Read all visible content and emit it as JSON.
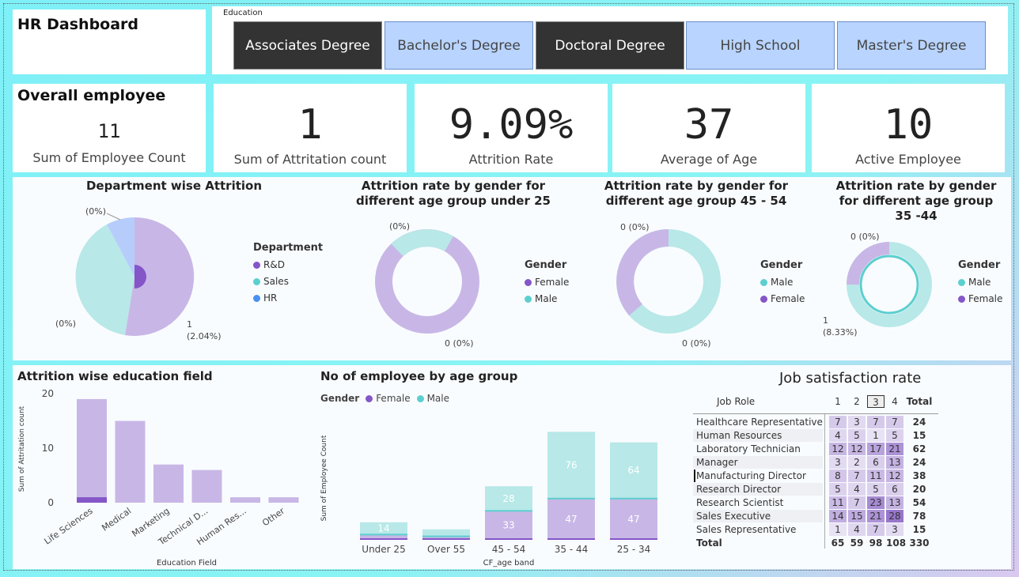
{
  "header": {
    "title": "HR Dashboard",
    "education_label": "Education",
    "education_options": [
      {
        "label": "Associates Degree",
        "selected": true
      },
      {
        "label": "Bachelor's Degree",
        "selected": false
      },
      {
        "label": "Doctoral Degree",
        "selected": true
      },
      {
        "label": "High School",
        "selected": false
      },
      {
        "label": "Master's Degree",
        "selected": false
      }
    ]
  },
  "kpis": {
    "overall_title": "Overall employee",
    "employee_count": {
      "value": "11",
      "label": "Sum of Employee Count"
    },
    "attrition_count": {
      "value": "1",
      "label": "Sum of Attritation count"
    },
    "attrition_rate": {
      "value": "9.09%",
      "label": "Attrition Rate"
    },
    "average_age": {
      "value": "37",
      "label": "Average of Age"
    },
    "active_employee": {
      "value": "10",
      "label": "Active Employee"
    }
  },
  "colors": {
    "purple": "#c8b7e6",
    "purple_dark": "#8456c8",
    "teal": "#b8e8e8",
    "teal_dark": "#5ccfcf",
    "blue_light": "#b6cdfc",
    "blue": "#4a90f0"
  },
  "chart_data": [
    {
      "type": "pie",
      "title": "Department wise Attrition",
      "legend_title": "Department",
      "categories": [
        "R&D",
        "Sales",
        "HR"
      ],
      "values": [
        2.04,
        0,
        0
      ],
      "labels": [
        "1\n(2.04%)",
        "(0%)",
        "(0%)"
      ],
      "colors": [
        "#8456c8",
        "#5ccfcf",
        "#4a90f0"
      ]
    },
    {
      "type": "pie",
      "title": "Attrition rate by gender for different age group under 25",
      "legend_title": "Gender",
      "categories": [
        "Female",
        "Male"
      ],
      "values": [
        0,
        0
      ],
      "labels": [
        "0 (0%)",
        "(0%)"
      ],
      "colors": [
        "#8456c8",
        "#5ccfcf"
      ]
    },
    {
      "type": "pie",
      "title": "Attrition rate by gender for different age group 45 - 54",
      "legend_title": "Gender",
      "categories": [
        "Male",
        "Female"
      ],
      "values": [
        0,
        0
      ],
      "labels": [
        "0 (0%)",
        "0 (0%)"
      ],
      "colors": [
        "#5ccfcf",
        "#8456c8"
      ]
    },
    {
      "type": "pie",
      "title": "Attrition rate by gender for different age group 35 -44",
      "legend_title": "Gender",
      "categories": [
        "Male",
        "Female"
      ],
      "values": [
        8.33,
        0
      ],
      "labels": [
        "1\n(8.33%)",
        "0 (0%)"
      ],
      "colors": [
        "#5ccfcf",
        "#8456c8"
      ]
    },
    {
      "type": "bar",
      "title": "Attrition wise education field",
      "xlabel": "Education Field",
      "ylabel": "Sum of Attritation count",
      "categories": [
        "Life Sciences",
        "Medical",
        "Marketing",
        "Technical D...",
        "Human Res...",
        "Other"
      ],
      "series": [
        {
          "values": [
            19,
            15,
            7,
            6,
            1,
            1
          ]
        },
        {
          "values": [
            1,
            0,
            0,
            0,
            0,
            0
          ]
        }
      ],
      "yticks": [
        0,
        10,
        20
      ],
      "ylim": [
        0,
        20
      ]
    },
    {
      "type": "bar",
      "title": "No of employee by age group",
      "xlabel": "CF_age band",
      "ylabel": "Sum of Employee Count",
      "legend_title": "Gender",
      "categories": [
        "Under 25",
        "Over 55",
        "45 - 54",
        "35 - 44",
        "25 - 34"
      ],
      "series": [
        {
          "name": "Female",
          "values": [
            6,
            4,
            33,
            47,
            47
          ]
        },
        {
          "name": "Male",
          "values": [
            14,
            8,
            28,
            76,
            64
          ]
        }
      ],
      "ylim": [
        0,
        135
      ]
    }
  ],
  "job_satisfaction": {
    "title": "Job satisfaction rate",
    "columns": [
      "Job Role",
      "1",
      "2",
      "3",
      "4",
      "Total"
    ],
    "rows": [
      {
        "role": "Healthcare Representative",
        "v": [
          7,
          3,
          7,
          7
        ],
        "total": 24
      },
      {
        "role": "Human Resources",
        "v": [
          4,
          5,
          1,
          5
        ],
        "total": 15
      },
      {
        "role": "Laboratory Technician",
        "v": [
          12,
          12,
          17,
          21
        ],
        "total": 62
      },
      {
        "role": "Manager",
        "v": [
          3,
          2,
          6,
          13
        ],
        "total": 24
      },
      {
        "role": "Manufacturing Director",
        "v": [
          8,
          7,
          11,
          12
        ],
        "total": 38
      },
      {
        "role": "Research Director",
        "v": [
          5,
          4,
          5,
          6
        ],
        "total": 20
      },
      {
        "role": "Research Scientist",
        "v": [
          11,
          7,
          23,
          13
        ],
        "total": 54
      },
      {
        "role": "Sales Executive",
        "v": [
          14,
          15,
          21,
          28
        ],
        "total": 78
      },
      {
        "role": "Sales Representative",
        "v": [
          1,
          4,
          7,
          3
        ],
        "total": 15
      }
    ],
    "total_row": {
      "role": "Total",
      "v": [
        65,
        59,
        98,
        108
      ],
      "total": 330
    }
  }
}
